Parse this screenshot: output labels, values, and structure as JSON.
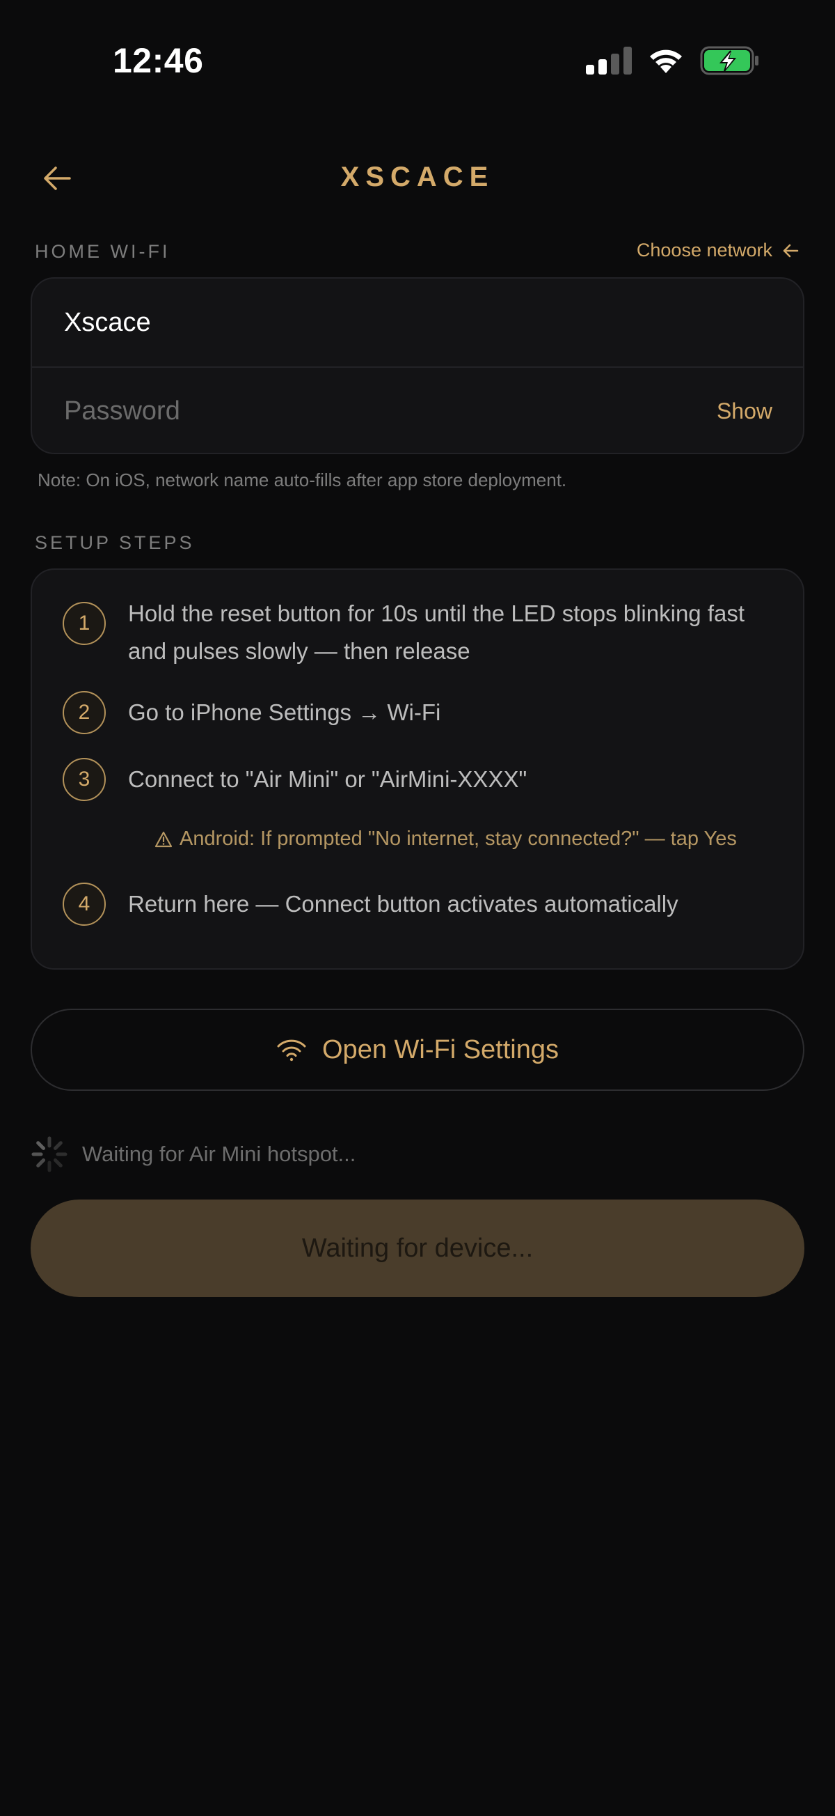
{
  "status_bar": {
    "time": "12:46",
    "icons": [
      "cellular-signal-icon",
      "wifi-icon",
      "battery-charging-icon"
    ]
  },
  "header": {
    "brand": "XSCACE",
    "back_icon": "arrow-left-icon"
  },
  "wifi_section": {
    "label": "HOME WI-FI",
    "choose_network": "Choose network",
    "ssid": "Xscace",
    "password_placeholder": "Password",
    "show_label": "Show",
    "note": "Note: On iOS, network name auto-fills after app store deployment."
  },
  "steps_section": {
    "label": "SETUP STEPS",
    "steps": [
      {
        "num": "1",
        "text": "Hold the reset button for 10s until the LED stops blinking fast and pulses slowly — then release"
      },
      {
        "num": "2",
        "text": "Go to iPhone Settings → Wi-Fi"
      },
      {
        "num": "3",
        "text": "Connect to \"Air Mini\" or \"AirMini-XXXX\""
      },
      {
        "num": "4",
        "text": "Return here — Connect button activates automatically"
      }
    ],
    "warning": "Android: If prompted \"No internet, stay connected?\" — tap Yes"
  },
  "actions": {
    "open_wifi": "Open Wi-Fi Settings",
    "waiting_status": "Waiting for Air Mini hotspot...",
    "connect_button": "Waiting for device..."
  },
  "colors": {
    "accent": "#d4aa6a",
    "background": "#0b0b0c",
    "card": "#131315",
    "disabled_button": "#4a3d2b",
    "battery_fill": "#34c759"
  }
}
